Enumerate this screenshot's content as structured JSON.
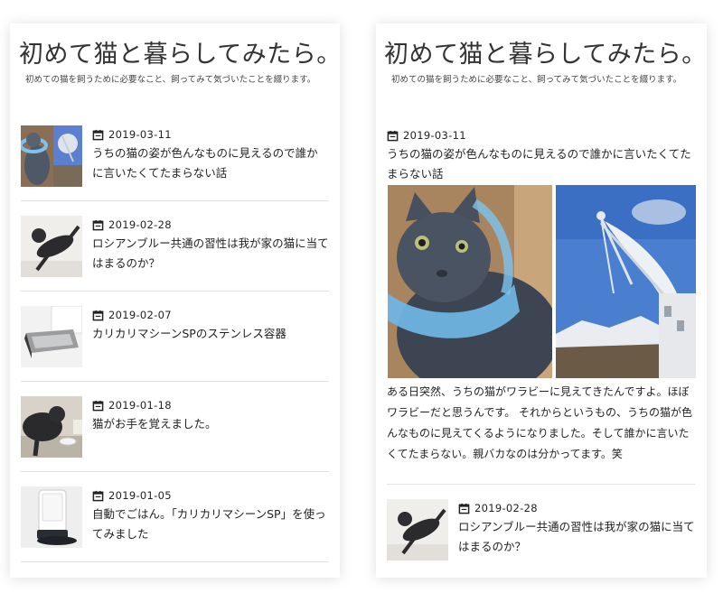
{
  "site": {
    "title": "初めて猫と暮らしてみたら。",
    "description": "初めての猫を飼うために必要なこと、飼ってみて気づいたことを綴ります。"
  },
  "left_posts": [
    {
      "date": "2019-03-11",
      "title": "うちの猫の姿が色んなものに見えるので誰かに言いたくてたまらない話",
      "thumb": "cat-and-antenna"
    },
    {
      "date": "2019-02-28",
      "title": "ロシアンブルー共通の習性は我が家の猫に当てはまるのか？",
      "thumb": "cat-lying"
    },
    {
      "date": "2019-02-07",
      "title": "カリカリマシーンSPのステンレス容器",
      "thumb": "feeder-bowl"
    },
    {
      "date": "2019-01-18",
      "title": "猫がお手を覚えました。",
      "thumb": "cat-paw"
    },
    {
      "date": "2019-01-05",
      "title": "自動でごはん。「カリカリマシーンSP」を使ってみました",
      "thumb": "auto-feeder"
    }
  ],
  "featured": {
    "date": "2019-03-11",
    "title": "うちの猫の姿が色んなものに見えるので誰かに言いたくてたまらない話",
    "excerpt": "ある日突然、うちの猫がワラビーに見えてきたんですよ。ほぼワラビーだと思うんです。 それからというもの、うちの猫が色んなものに見えてくるようになりました。そして誰かに言いたくてたまらない。親バカなのは分かってます。笑"
  },
  "right_next": {
    "date": "2019-02-28",
    "title": "ロシアンブルー共通の習性は我が家の猫に当てはまるのか？",
    "thumb": "cat-lying"
  },
  "icons": {
    "date": "calendar-icon"
  },
  "colors": {
    "text": "#222222",
    "divider": "#e3e3e3",
    "cone": "#6fb7e6",
    "sky": "#4a7fd0"
  }
}
